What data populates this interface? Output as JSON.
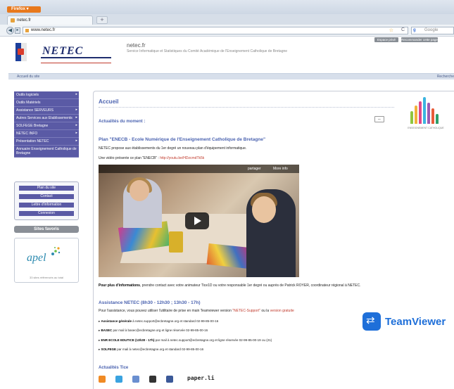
{
  "browser": {
    "menu_label": "Firefox ▾",
    "tab_title": "netec.fr",
    "new_tab": "+",
    "url": "www.netec.fr",
    "search_placeholder": "Google"
  },
  "header": {
    "logo_text": "NETEC",
    "site_name": "netec.fr",
    "site_subtitle": "Service Informatique et Statistiques du Comité Académique de l'Enseignement Catholique de Bretagne",
    "btn_print": "Espace privé",
    "btn_recommend": "Recommander cette page"
  },
  "breadcrumb": {
    "home": "Accueil du site",
    "search": "Recherche"
  },
  "sidebar": {
    "menu": [
      {
        "label": "Outils logiciels",
        "arrow": true
      },
      {
        "label": "Outils Matériels",
        "arrow": false
      },
      {
        "label": "Assistance SERVEURS",
        "arrow": true
      },
      {
        "label": "Autres Services aux Etablissements",
        "arrow": true
      },
      {
        "label": "SOLFEGE Bretagne",
        "arrow": true
      },
      {
        "label": "NETEC INFO",
        "arrow": true
      },
      {
        "label": "Présentation NETEC",
        "arrow": true
      },
      {
        "label": "Annuaire Enseignement Catholique de Bretagne",
        "arrow": false
      }
    ],
    "links": [
      "Plan du site",
      "Contact",
      "Lettre d'information",
      "Connexion"
    ],
    "favorites_title": "Sites favoris",
    "apel_logo": "apel",
    "apel_caption": "33 sites référencés au total"
  },
  "main": {
    "title": "Accueil",
    "news_heading": "Actualités du moment :",
    "ec_logo_caption": "ENSEIGNEMENT CATHOLIQUE",
    "article_title": "Plan \"ENECB - Ecole Numérique de l'Enseignement Catholique de Bretagne\"",
    "article_p1": "NETEC propose aux établissements du 1er degré un nouveau plan d'équipement informatique.",
    "article_p2_prefix": "Une vidéo présente ce plan \"ENECB\" : ",
    "article_p2_link": "http://youtu.be/HDzcmdTk5k",
    "video_share": "partager",
    "video_more": "More info",
    "info_bold": "Pour plus d'informations",
    "info_rest": ", prendre contact avec votre animateur Tice1D ou votre responsable 1er degré ou auprès de Patrick ROYER, coordinateur régional à NETEC.",
    "assist_title": "Assistance NETEC (8h30 - 12h30 ; 13h30 - 17h)",
    "assist_intro_prefix": "Pour l'assistance, vous pouvez utiliser l'utilitaire de prise en main Teamviewer version ",
    "assist_intro_link1": "\"NETEC-Support\"",
    "assist_intro_mid": " ou la ",
    "assist_intro_link2": "version gratuite",
    "teamviewer": "TeamViewer",
    "bullets": [
      {
        "bold": "Assistance générale",
        "text": " à netec.support@ecbretagne.org et standard 02-99-85-00-16"
      },
      {
        "bold": "BASEC",
        "text": " par mail à basec@ecbretagne.org et ligne réservée 02-99-85-00-16"
      },
      {
        "bold": "ENR ECOLE EDUTICE (13h30 - 17h)",
        "text": " par mail à netec.support@ecbretagne.org et ligne réservée 02-99-85-00-19 ou (21)"
      },
      {
        "bold": "SOLFEGE",
        "text": " par mail à netec@ecbretagne.org et standard 02-99-85-00-16"
      }
    ],
    "tice_heading": "Actualités Tice",
    "paperli": "paper.li"
  },
  "colors": {
    "menu": "#5a5aa5",
    "heading": "#4b63b0",
    "link": "#c0392b",
    "teamviewer": "#1e6fd9"
  }
}
